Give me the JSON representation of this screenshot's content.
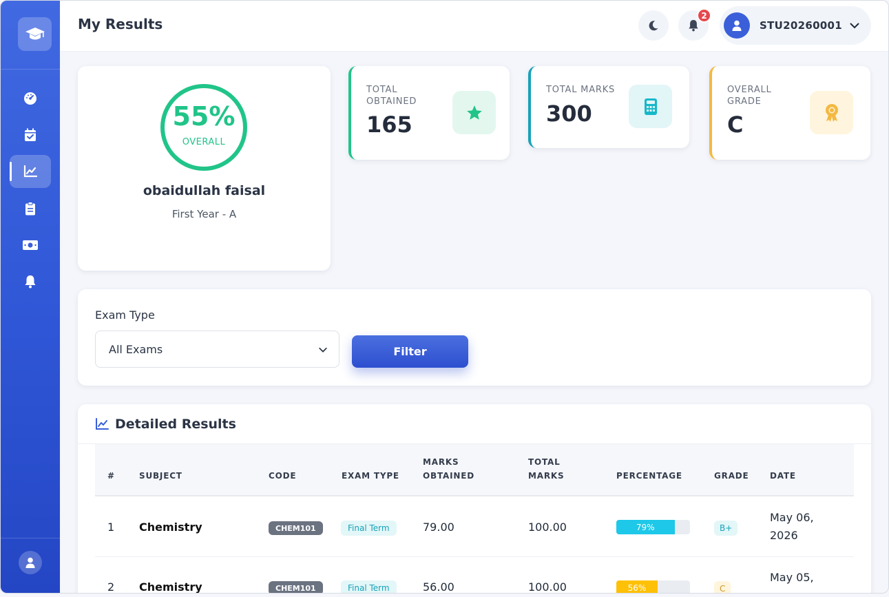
{
  "header": {
    "title": "My Results",
    "notification_count": "2",
    "user_id": "STU20260001"
  },
  "sidebar": {
    "items": [
      {
        "name": "dashboard",
        "icon": "gauge-icon"
      },
      {
        "name": "attendance",
        "icon": "calendar-check-icon"
      },
      {
        "name": "results",
        "icon": "chart-line-icon",
        "active": true
      },
      {
        "name": "assignments",
        "icon": "clipboard-icon"
      },
      {
        "name": "fees",
        "icon": "money-bill-icon"
      },
      {
        "name": "notifications",
        "icon": "bell-icon"
      }
    ]
  },
  "profile": {
    "overall_pct": "55%",
    "overall_value": 0.55,
    "overall_label": "OVERALL",
    "name": "obaidullah faisal",
    "class": "First Year - A"
  },
  "stats": {
    "obtained": {
      "label": "TOTAL OBTAINED",
      "value": "165",
      "color": "#21c489"
    },
    "total": {
      "label": "TOTAL MARKS",
      "value": "300",
      "color": "#17a2b8"
    },
    "grade": {
      "label": "OVERALL GRADE",
      "value": "C",
      "color": "#f4b942"
    }
  },
  "filter": {
    "label": "Exam Type",
    "selected": "All Exams",
    "button": "Filter"
  },
  "results": {
    "title": "Detailed Results",
    "columns": {
      "num": "#",
      "subject": "SUBJECT",
      "code": "CODE",
      "exam_type": "EXAM TYPE",
      "marks_obtained": "MARKS OBTAINED",
      "total_marks": "TOTAL MARKS",
      "percentage": "PERCENTAGE",
      "grade": "GRADE",
      "date": "DATE"
    },
    "rows": [
      {
        "num": "1",
        "subject": "Chemistry",
        "code": "CHEM101",
        "exam_type": "Final Term",
        "obtained": "79.00",
        "total": "100.00",
        "pct_label": "79%",
        "pct": 0.79,
        "pct_color": "#1ec8e8",
        "grade": "B+",
        "grade_bg": "#e3f6f8",
        "grade_color": "#17a2b8",
        "date": "May 06, 2026"
      },
      {
        "num": "2",
        "subject": "Chemistry",
        "code": "CHEM101",
        "exam_type": "Final Term",
        "obtained": "56.00",
        "total": "100.00",
        "pct_label": "56%",
        "pct": 0.56,
        "pct_color": "#ffc107",
        "grade": "C",
        "grade_bg": "#fff5dc",
        "grade_color": "#c9952a",
        "date": "May 05,"
      }
    ]
  }
}
